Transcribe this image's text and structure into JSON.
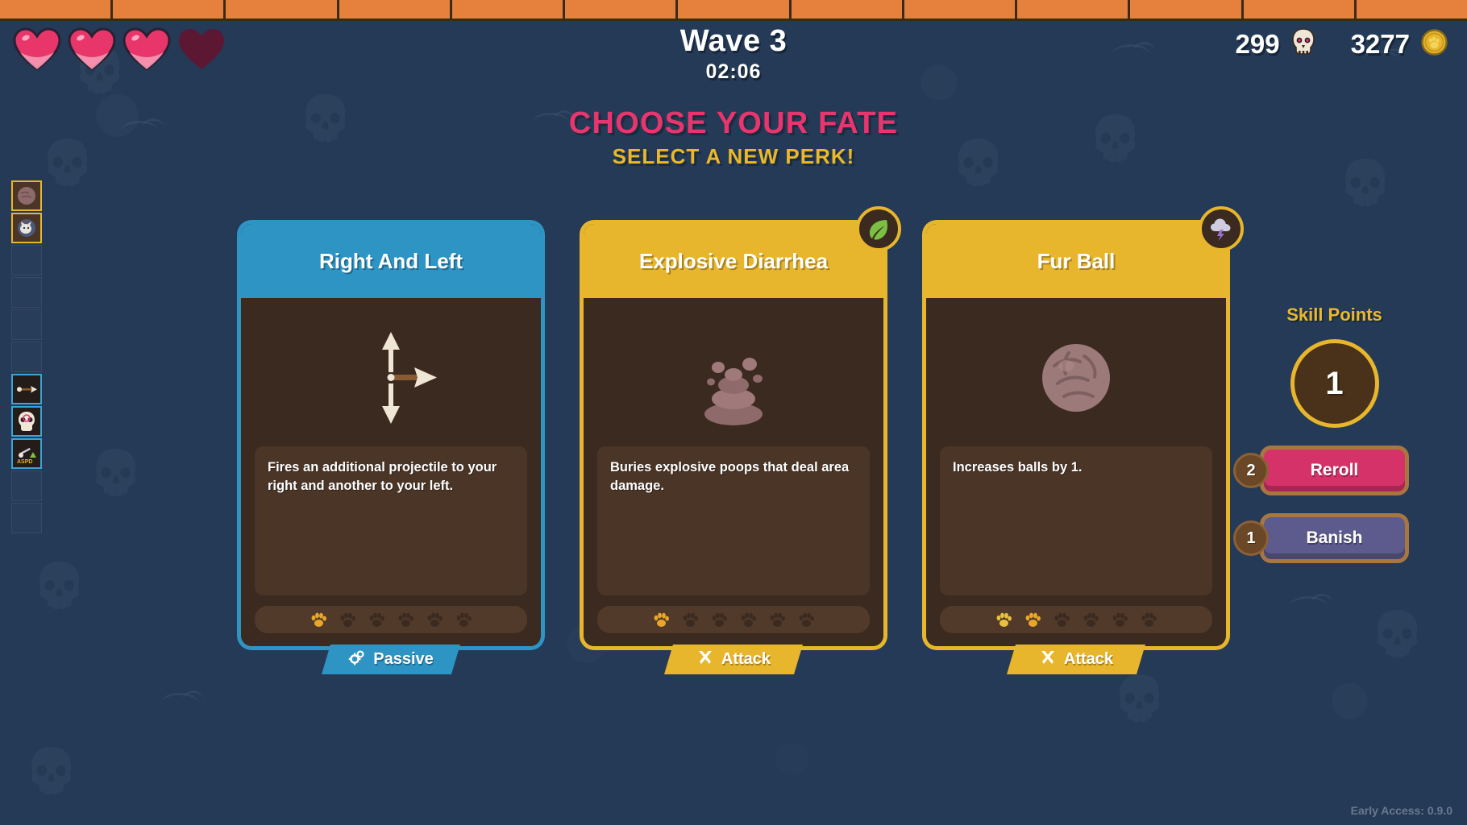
{
  "topbar": {
    "segments": 13,
    "color": "#e5813c"
  },
  "hud": {
    "hearts": {
      "total": 4,
      "filled": 3,
      "full_color": "#e8366b",
      "empty_color": "#5c1733"
    },
    "wave_label": "Wave 3",
    "timer": "02:06",
    "kills": {
      "value": "299",
      "icon": "skull-icon"
    },
    "coins": {
      "value": "3277",
      "icon": "coin-icon"
    }
  },
  "titles": {
    "main": "CHOOSE YOUR FATE",
    "main_color": "#e8356d",
    "sub": "SELECT A NEW PERK!",
    "sub_color": "#eab82a"
  },
  "cards": [
    {
      "name": "Right And Left",
      "header_color": "#2e94c4",
      "frame": "blue",
      "art_icon": "three-arrows-icon",
      "description": "Fires an additional projectile to your right and another to your left.",
      "paws_total": 6,
      "paws_filled": 1,
      "type_label": "Passive",
      "type_icon": "gears-icon",
      "type_style": "passive",
      "element_badge": null
    },
    {
      "name": "Explosive Diarrhea",
      "header_color": "#e8b62c",
      "frame": "gold",
      "art_icon": "poop-icon",
      "description": "Buries explosive poops that deal area damage.",
      "paws_total": 6,
      "paws_filled": 1,
      "type_label": "Attack",
      "type_icon": "crossed-swords-icon",
      "type_style": "attack",
      "element_badge": "leaf-icon"
    },
    {
      "name": "Fur Ball",
      "header_color": "#e8b62c",
      "frame": "gold",
      "art_icon": "furball-icon",
      "description": "Increases balls by 1.",
      "paws_total": 6,
      "paws_filled": 2,
      "type_label": "Attack",
      "type_icon": "crossed-swords-icon",
      "type_style": "attack",
      "element_badge": "storm-icon"
    }
  ],
  "skill_panel": {
    "label": "Skill Points",
    "value": "1",
    "actions": [
      {
        "label": "Reroll",
        "count": "2",
        "style": "reroll"
      },
      {
        "label": "Banish",
        "count": "1",
        "style": "banish"
      }
    ]
  },
  "inventory": {
    "slots": [
      {
        "state": "gold",
        "icon": "furball-item-icon"
      },
      {
        "state": "gold",
        "icon": "cat-item-icon"
      },
      {
        "state": "empty",
        "icon": ""
      },
      {
        "state": "empty",
        "icon": ""
      },
      {
        "state": "empty",
        "icon": ""
      },
      {
        "state": "empty",
        "icon": ""
      },
      {
        "state": "blue",
        "icon": "arrow-item-icon"
      },
      {
        "state": "blue",
        "icon": "skull-item-icon"
      },
      {
        "state": "blue",
        "icon": "aspd-item-icon"
      },
      {
        "state": "empty",
        "icon": ""
      },
      {
        "state": "empty",
        "icon": ""
      }
    ]
  },
  "version": "Early Access: 0.9.0"
}
